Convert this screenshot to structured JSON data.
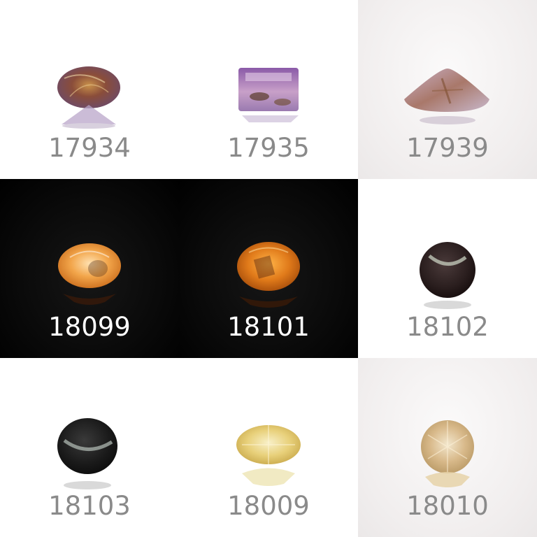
{
  "tiles": [
    {
      "code": "17934",
      "gem": "rutilated-amethyst-oval"
    },
    {
      "code": "17935",
      "gem": "ametrine-emerald-cut"
    },
    {
      "code": "17939",
      "gem": "rutilated-quartz-trillion"
    },
    {
      "code": "18099",
      "gem": "sunstone-oval"
    },
    {
      "code": "18101",
      "gem": "sunstone-oval"
    },
    {
      "code": "18102",
      "gem": "cats-eye-cabochon"
    },
    {
      "code": "18103",
      "gem": "cats-eye-cabochon"
    },
    {
      "code": "18009",
      "gem": "yellow-oval-faceted"
    },
    {
      "code": "18010",
      "gem": "champagne-round-faceted"
    }
  ],
  "colors": {
    "label_on_light": "#8a8a8a",
    "label_on_dark": "#ffffff",
    "dark_background": "#0a0a0a"
  }
}
